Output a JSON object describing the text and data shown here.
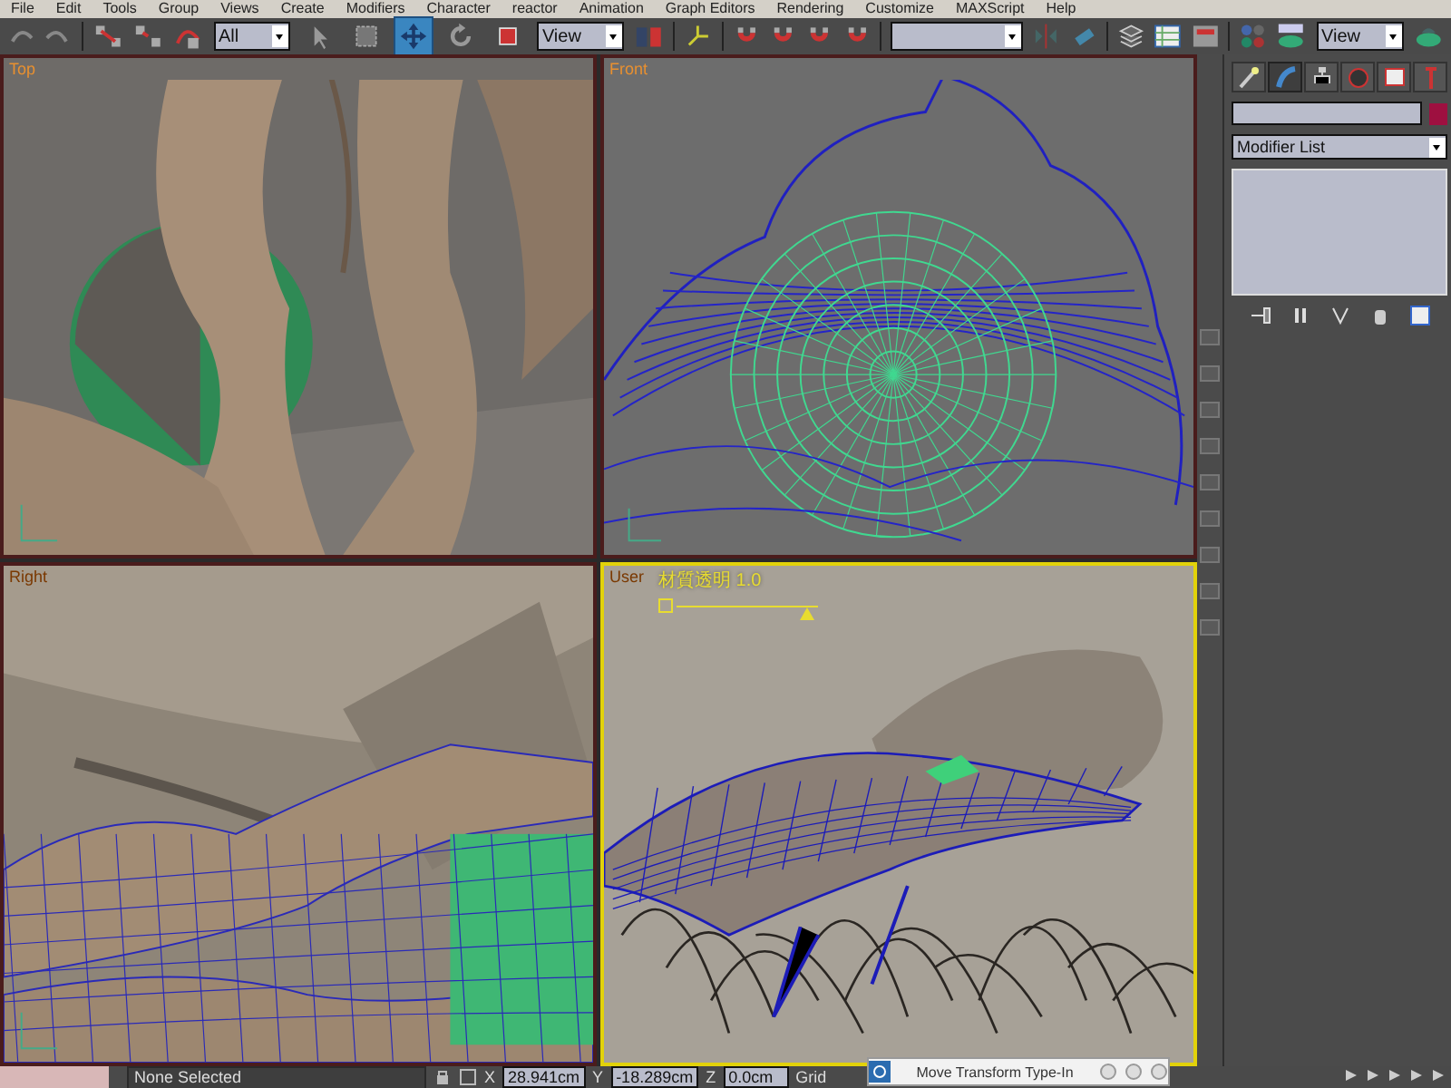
{
  "menu": [
    "File",
    "Edit",
    "Tools",
    "Group",
    "Views",
    "Create",
    "Modifiers",
    "Character",
    "reactor",
    "Animation",
    "Graph Editors",
    "Rendering",
    "Customize",
    "MAXScript",
    "Help"
  ],
  "toolbar": {
    "selection_filter": "All",
    "reference_coord": "View",
    "view_dropdown": "View",
    "tools": [
      {
        "kind": "select",
        "selected": false
      },
      {
        "kind": "region",
        "selected": false
      },
      {
        "kind": "move",
        "selected": true
      },
      {
        "kind": "rotate",
        "selected": false
      },
      {
        "kind": "scale",
        "selected": false
      }
    ]
  },
  "viewports": [
    {
      "label": "Top",
      "kind": "top",
      "active": false
    },
    {
      "label": "Front",
      "kind": "front",
      "active": false
    },
    {
      "label": "Right",
      "kind": "right",
      "active": false
    },
    {
      "label": "User",
      "kind": "user",
      "active": true,
      "overlay": {
        "label": "材質透明 1.0",
        "level": 0.92
      }
    }
  ],
  "command_panel": {
    "tabs": [
      {
        "kind": "create",
        "selected": false
      },
      {
        "kind": "modify",
        "selected": true
      },
      {
        "kind": "hierarchy",
        "selected": false
      },
      {
        "kind": "motion",
        "selected": false
      },
      {
        "kind": "display",
        "selected": false
      },
      {
        "kind": "utilities",
        "selected": false
      }
    ],
    "color": "#9e1040",
    "modifier_list": "Modifier List"
  },
  "status_bar": {
    "selection": "None Selected",
    "coordinates": [
      {
        "axis": "X",
        "value": "28.941cm"
      },
      {
        "axis": "Y",
        "value": "-18.289cm"
      },
      {
        "axis": "Z",
        "value": "0.0cm"
      }
    ],
    "grid": "Grid"
  },
  "dialog": {
    "title": "Move Transform Type-In"
  }
}
